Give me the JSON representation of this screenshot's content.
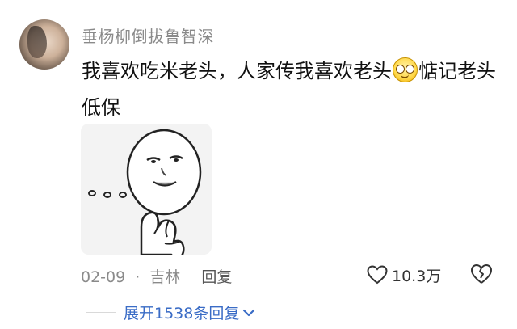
{
  "comment": {
    "username": "垂杨柳倒拔鲁智深",
    "text_before_emoji": "我喜欢吃米老头，人家传我喜欢老头",
    "emoji": "smile-emoji-icon",
    "text_after_emoji": "惦记老头低保",
    "date": "02-09",
    "separator": "·",
    "location": "吉林",
    "reply_label": "回复",
    "like_count": "10.3万",
    "expand_label": "展开1538条回复"
  },
  "colors": {
    "meta_gray": "#8a8a8a",
    "expand_blue": "#3a6cc6",
    "emoji_yellow": "#ffd84a"
  }
}
